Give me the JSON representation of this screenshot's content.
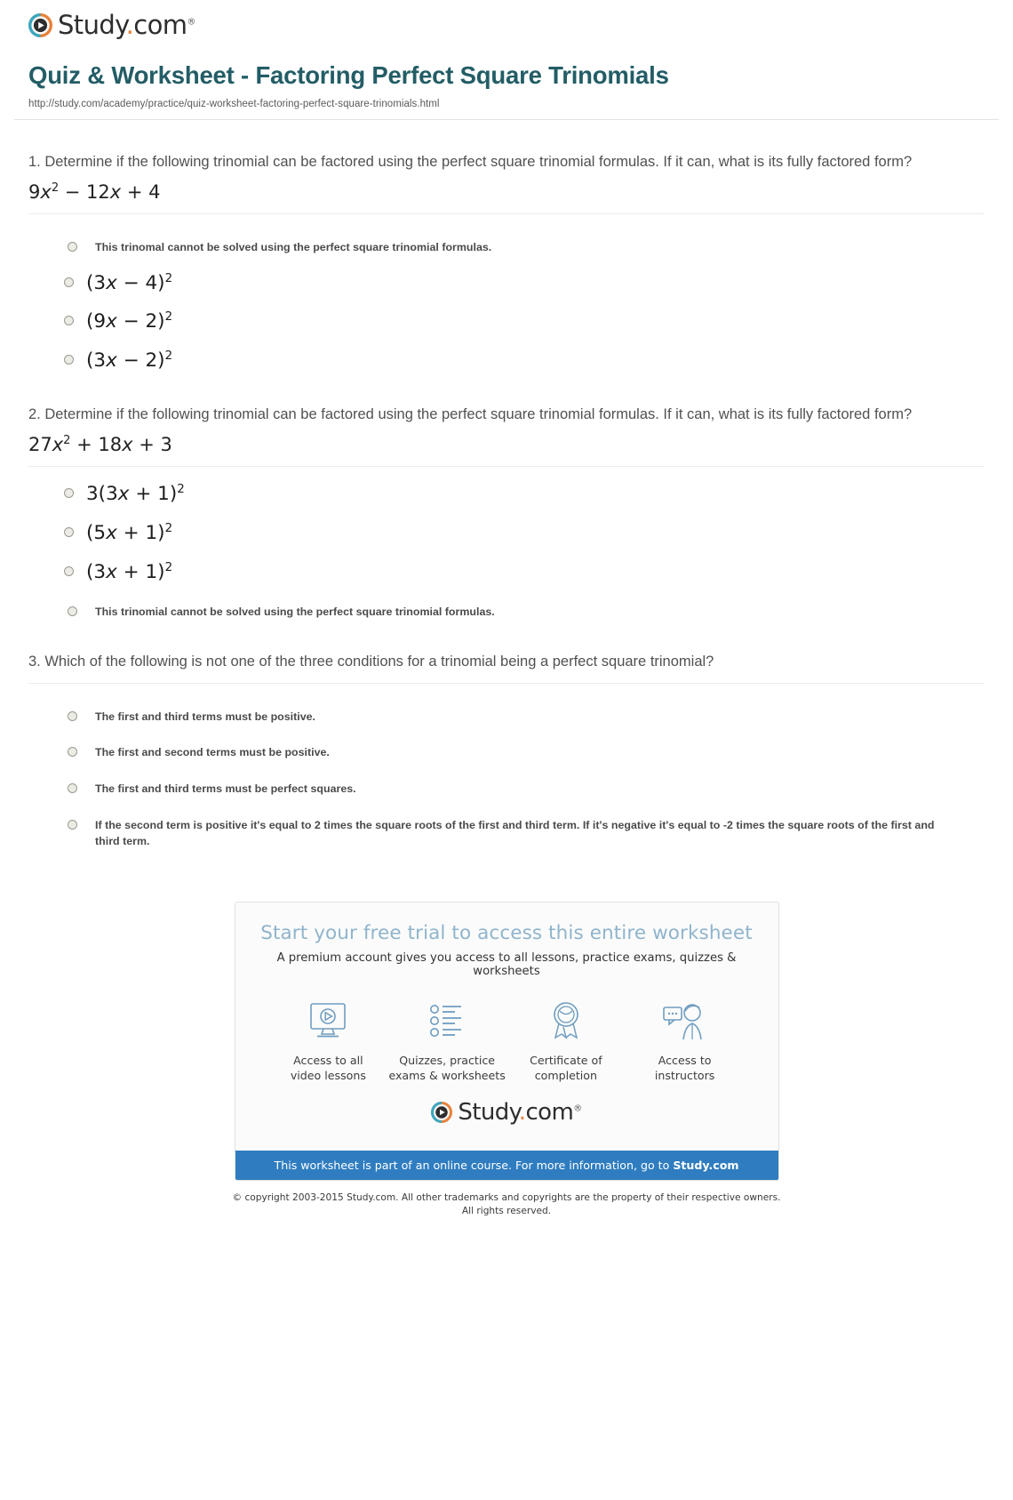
{
  "brand": {
    "name_main": "Study",
    "name_dot": ".",
    "name_tld": "com",
    "trademark": "®",
    "play_icon": "play-circle-icon"
  },
  "header": {
    "title": "Quiz & Worksheet - Factoring Perfect Square Trinomials",
    "url": "http://study.com/academy/practice/quiz-worksheet-factoring-perfect-square-trinomials.html"
  },
  "questions": [
    {
      "number": "1.",
      "prompt": "1. Determine if the following trinomial can be factored using the perfect square trinomial formulas. If it can, what is its fully factored form?",
      "expression_html": "9<i>x</i><sup>2</sup> − 12<i>x</i> + 4",
      "options": [
        {
          "kind": "text",
          "label": "This trinomal cannot be solved using the perfect square trinomial formulas."
        },
        {
          "kind": "math",
          "html": "(3<i>x</i> − 4)<sup>2</sup>"
        },
        {
          "kind": "math",
          "html": "(9<i>x</i> − 2)<sup>2</sup>"
        },
        {
          "kind": "math",
          "html": "(3<i>x</i> − 2)<sup>2</sup>"
        }
      ]
    },
    {
      "number": "2.",
      "prompt": "2. Determine if the following trinomial can be factored using the perfect square trinomial formulas. If it can, what is its fully factored form?",
      "expression_html": "27<i>x</i><sup>2</sup> + 18<i>x</i> + 3",
      "options": [
        {
          "kind": "math",
          "html": "3(3<i>x</i> + 1)<sup>2</sup>"
        },
        {
          "kind": "math",
          "html": "(5<i>x</i> + 1)<sup>2</sup>"
        },
        {
          "kind": "math",
          "html": "(3<i>x</i> + 1)<sup>2</sup>"
        },
        {
          "kind": "text",
          "label": "This trinomial cannot be solved using the perfect square trinomial formulas."
        }
      ]
    },
    {
      "number": "3.",
      "prompt": "3. Which of the following is not one of the three conditions for a trinomial being a perfect square trinomial?",
      "expression_html": "",
      "options": [
        {
          "kind": "text",
          "label": "The first and third terms must be positive."
        },
        {
          "kind": "text",
          "label": "The first and second terms must be positive."
        },
        {
          "kind": "text",
          "label": "The first and third terms must be perfect squares."
        },
        {
          "kind": "text",
          "label": "If the second term is positive it's equal to 2 times the square roots of the first and third term. If it's negative it's equal to -2 times the square roots of the first and third term."
        }
      ]
    }
  ],
  "promo": {
    "title": "Start your free trial to access this entire worksheet",
    "subtitle": "A premium account gives you access to all lessons, practice exams, quizzes & worksheets",
    "features": [
      {
        "icon": "video-monitor-icon",
        "line1": "Access to all",
        "line2": "video lessons"
      },
      {
        "icon": "checklist-icon",
        "line1": "Quizzes, practice",
        "line2": "exams & worksheets"
      },
      {
        "icon": "award-ribbon-icon",
        "line1": "Certificate of",
        "line2": "completion"
      },
      {
        "icon": "instructor-chat-icon",
        "line1": "Access to",
        "line2": "instructors"
      }
    ],
    "banner_prefix": "This worksheet is part of an online course. For more information, go to ",
    "banner_link": "Study.com",
    "accent_color": "#2f7dc0",
    "title_color": "#8fb4cc"
  },
  "footer": {
    "copyright_line1": "© copyright 2003-2015 Study.com. All other trademarks and copyrights are the property of their respective owners.",
    "copyright_line2": "All rights reserved."
  }
}
